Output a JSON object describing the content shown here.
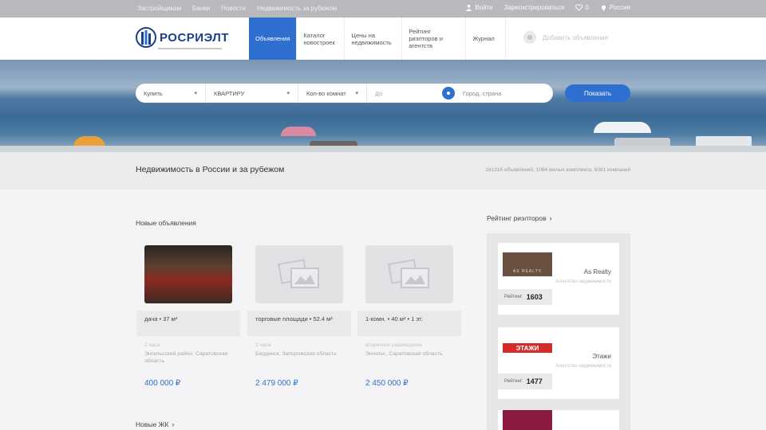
{
  "topbar": {
    "links": [
      "Застройщикам",
      "Банки",
      "Новости",
      "Недвижимость за рубежом"
    ],
    "login": "Войти",
    "register": "Зарегистрироваться",
    "favorites_count": "0",
    "region": "Россия"
  },
  "header": {
    "logo_text": "РОСРИЭЛТ",
    "nav": [
      "Объявления",
      "Каталог новостроек",
      "Цены на недвижимость",
      "Рейтинг риэлторов и агентств",
      "Журнал"
    ],
    "add_listing": "Добавить объявление"
  },
  "search": {
    "deal": "Купить",
    "type": "КВАРТИРУ",
    "rooms": "Кол-во комнат",
    "price_to": "До",
    "city_placeholder": "Город, страна",
    "button": "Показать"
  },
  "title_strip": {
    "title": "Недвижимость в России и за рубежом",
    "stats": "161316 объявлений, 1084 жилых комплекса, 6081 компаний"
  },
  "listings": {
    "section_title": "Новые объявления",
    "items": [
      {
        "title": "дача • 37 м²",
        "meta": "2 часа",
        "address": "Энгельсский район, Саратовская область",
        "price": "400 000 ₽",
        "image": "photo"
      },
      {
        "title": "торговые площади • 52.4 м²",
        "meta": "2 часа",
        "address": "Бердянск, Запорожская область",
        "price": "2 479 000 ₽",
        "image": "placeholder"
      },
      {
        "title": "1-комн. • 40 м² • 1 эт.",
        "meta": "вторичное размещение",
        "address": "Энгельс, Саратовская область",
        "price": "2 450 000 ₽",
        "image": "placeholder"
      }
    ]
  },
  "realtors": {
    "section_title": "Рейтинг риэлторов",
    "rating_label": "Рейтинг:",
    "items": [
      {
        "name": "As Realty",
        "type": "Агентство недвижимости",
        "rating": "1603",
        "logo_text": "AS REALTY"
      },
      {
        "name": "Этажи",
        "type": "Агентство недвижимости",
        "rating": "1477",
        "logo_text": "ЭТАЖИ"
      },
      {
        "name": "",
        "type": "",
        "rating": "",
        "logo_text": ""
      }
    ]
  },
  "new_complexes": {
    "section_title": "Новые ЖК"
  },
  "colors": {
    "accent": "#2f6fd0",
    "topbar": "#b9b9bd",
    "brand": "#1a3f8a"
  }
}
